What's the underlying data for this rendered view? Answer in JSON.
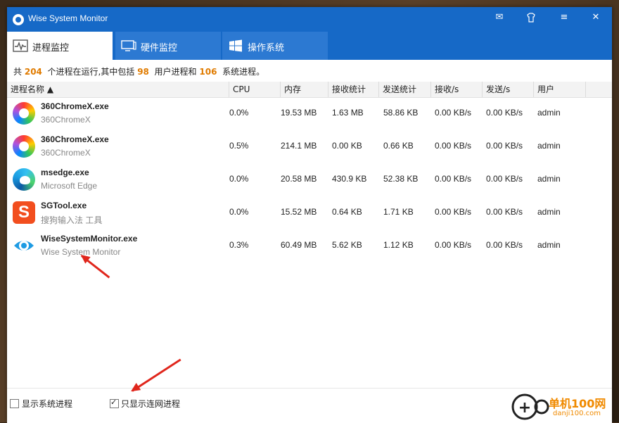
{
  "window": {
    "title": "Wise System Monitor"
  },
  "titlebar_buttons": [
    {
      "name": "mail-icon",
      "glyph": "✉"
    },
    {
      "name": "skin-icon",
      "glyph": "■"
    },
    {
      "name": "menu-icon",
      "glyph": "≡"
    },
    {
      "name": "close-icon",
      "glyph": "✕"
    }
  ],
  "tabs": [
    {
      "label": "进程监控",
      "icon": "activity-icon"
    },
    {
      "label": "硬件监控",
      "icon": "monitor-icon"
    },
    {
      "label": "操作系统",
      "icon": "windows-icon"
    }
  ],
  "summary": {
    "prefix": "共",
    "total": "204",
    "mid1": "个进程在运行,其中包括",
    "user": "98",
    "mid2": "用户进程和",
    "system": "106",
    "suffix": "系统进程。"
  },
  "columns": [
    "进程名称 ▲",
    "CPU",
    "内存",
    "接收统计",
    "发送统计",
    "接收/s",
    "发送/s",
    "用户"
  ],
  "processes": [
    {
      "name": "360ChromeX.exe",
      "desc": "360ChromeX",
      "cpu": "0.0%",
      "mem": "19.53 MB",
      "recv_total": "1.63 MB",
      "send_total": "58.86 KB",
      "recv_rate": "0.00 KB/s",
      "send_rate": "0.00 KB/s",
      "user": "admin",
      "icon": "chrome360-icon"
    },
    {
      "name": "360ChromeX.exe",
      "desc": "360ChromeX",
      "cpu": "0.5%",
      "mem": "214.1 MB",
      "recv_total": "0.00 KB",
      "send_total": "0.66 KB",
      "recv_rate": "0.00 KB/s",
      "send_rate": "0.00 KB/s",
      "user": "admin",
      "icon": "chrome360-icon"
    },
    {
      "name": "msedge.exe",
      "desc": "Microsoft Edge",
      "cpu": "0.0%",
      "mem": "20.58 MB",
      "recv_total": "430.9 KB",
      "send_total": "52.38 KB",
      "recv_rate": "0.00 KB/s",
      "send_rate": "0.00 KB/s",
      "user": "admin",
      "icon": "edge-icon"
    },
    {
      "name": "SGTool.exe",
      "desc": "搜狗输入法 工具",
      "cpu": "0.0%",
      "mem": "15.52 MB",
      "recv_total": "0.64 KB",
      "send_total": "1.71 KB",
      "recv_rate": "0.00 KB/s",
      "send_rate": "0.00 KB/s",
      "user": "admin",
      "icon": "sogou-icon"
    },
    {
      "name": "WiseSystemMonitor.exe",
      "desc": "Wise System Monitor",
      "cpu": "0.3%",
      "mem": "60.49 MB",
      "recv_total": "5.62 KB",
      "send_total": "1.12 KB",
      "recv_rate": "0.00 KB/s",
      "send_rate": "0.00 KB/s",
      "user": "admin",
      "icon": "wise-monitor-icon"
    }
  ],
  "footer": {
    "show_system": {
      "label": "显示系统进程",
      "checked": false
    },
    "show_network": {
      "label": "只显示连网进程",
      "checked": true
    }
  },
  "watermark": {
    "text1": "单机100网",
    "text2": "danji100.com"
  },
  "colors": {
    "titlebar": "#1669c7",
    "accent_number": "#e07b00",
    "annotation_arrow": "#e0261c"
  }
}
